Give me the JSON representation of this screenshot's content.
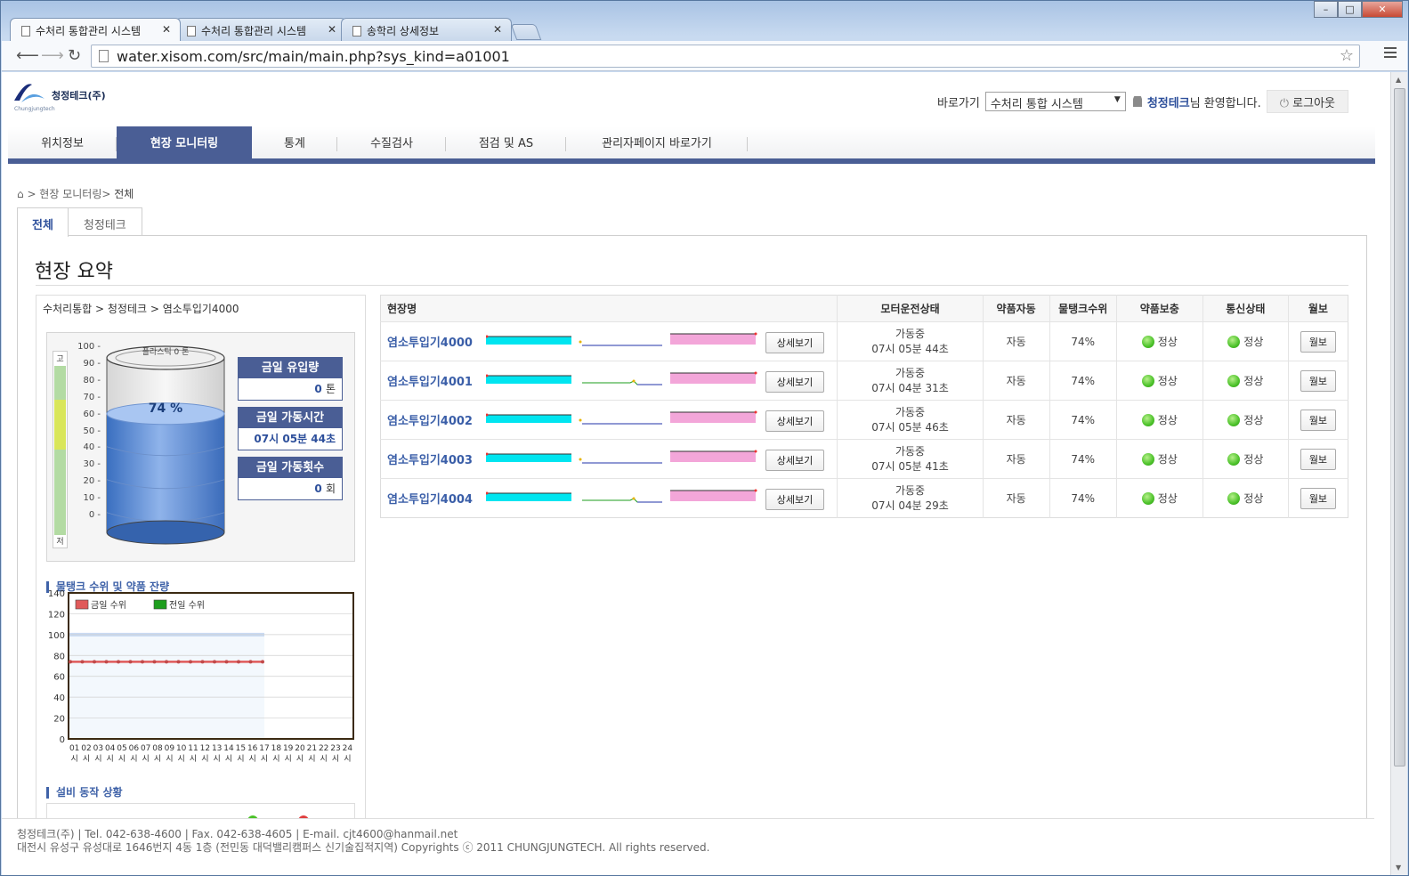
{
  "browser": {
    "tabs": [
      {
        "label": "수처리 통합관리 시스템"
      },
      {
        "label": "수처리 통합관리 시스템"
      },
      {
        "label": "송학리 상세정보"
      }
    ],
    "url": "water.xisom.com/src/main/main.php?sys_kind=a01001"
  },
  "header": {
    "logo_name": "청정테크(주)",
    "logo_sub": "Chungjungtech",
    "shortcut_label": "바로가기",
    "shortcut_selected": "수처리 통합 시스템",
    "user_name": "청정테크",
    "welcome_suffix": "님 환영합니다.",
    "logout_label": "로그아웃"
  },
  "gnb": [
    {
      "label": "위치정보"
    },
    {
      "label": "현장 모니터링"
    },
    {
      "label": "통계"
    },
    {
      "label": "수질검사"
    },
    {
      "label": "점검 및 AS"
    },
    {
      "label": "관리자페이지 바로가기"
    }
  ],
  "breadcrumb": {
    "path": " > 현장 모니터링> ",
    "current": "전체"
  },
  "page_tabs": [
    {
      "label": "전체"
    },
    {
      "label": "청정테크"
    }
  ],
  "page_title": "현장 요약",
  "left_panel": {
    "path": "수처리통합 > 청정테크 > 염소투입기4000",
    "gauge_high": "고",
    "gauge_low": "저",
    "scale": [
      "100 -",
      "90 -",
      "80 -",
      "70 -",
      "60 -",
      "50 -",
      "40 -",
      "30 -",
      "20 -",
      "10 -",
      "0 -"
    ],
    "tank_label": "플라스틱 0 톤",
    "tank_level": 0.74,
    "tank_level_text": "74 %",
    "stats": [
      {
        "title": "금일 유입량",
        "value": "0",
        "unit": "톤"
      },
      {
        "title": "금일 가동시간",
        "value": "07시 05분 44초",
        "unit": ""
      },
      {
        "title": "금일 가동횟수",
        "value": "0",
        "unit": "회"
      }
    ],
    "chart_title": "물탱크 수위 및 약품 잔량",
    "status_title": "설비 동작 상황"
  },
  "chart_data": {
    "type": "line",
    "ylim": [
      0,
      140
    ],
    "yticks": [
      0,
      20,
      40,
      60,
      80,
      100,
      120,
      140
    ],
    "categories": [
      "01시",
      "02시",
      "03시",
      "04시",
      "05시",
      "06시",
      "07시",
      "08시",
      "09시",
      "10시",
      "11시",
      "12시",
      "13시",
      "14시",
      "15시",
      "16시",
      "17시",
      "18시",
      "19시",
      "20시",
      "21시",
      "22시",
      "23시",
      "24시"
    ],
    "series": [
      {
        "name": "금일 수위",
        "color": "#e05a5a",
        "values": [
          74,
          74,
          74,
          74,
          74,
          74,
          74,
          74,
          74,
          74,
          74,
          74,
          74,
          74,
          74,
          74,
          74
        ]
      },
      {
        "name": "전일 수위",
        "color": "#1e9e1e",
        "values": []
      }
    ],
    "band_value": 100,
    "band_until_index": 16
  },
  "table": {
    "headers": [
      "현장명",
      "모터운전상태",
      "약품자동",
      "물탱크수위",
      "약품보충",
      "통신상태",
      "월보"
    ],
    "detail_label": "상세보기",
    "report_label": "월보",
    "rows": [
      {
        "name": "염소투입기4000",
        "motor": "가동중",
        "time": "07시 05분 44초",
        "auto": "자동",
        "level": "74%",
        "refill": "정상",
        "comm": "정상",
        "spark_bump": false
      },
      {
        "name": "염소투입기4001",
        "motor": "가동중",
        "time": "07시 04분 31초",
        "auto": "자동",
        "level": "74%",
        "refill": "정상",
        "comm": "정상",
        "spark_bump": true
      },
      {
        "name": "염소투입기4002",
        "motor": "가동중",
        "time": "07시 05분 46초",
        "auto": "자동",
        "level": "74%",
        "refill": "정상",
        "comm": "정상",
        "spark_bump": false
      },
      {
        "name": "염소투입기4003",
        "motor": "가동중",
        "time": "07시 05분 41초",
        "auto": "자동",
        "level": "74%",
        "refill": "정상",
        "comm": "정상",
        "spark_bump": false
      },
      {
        "name": "염소투입기4004",
        "motor": "가동중",
        "time": "07시 04분 29초",
        "auto": "자동",
        "level": "74%",
        "refill": "정상",
        "comm": "정상",
        "spark_bump": true
      }
    ]
  },
  "footer": {
    "line1": "청정테크(주) | Tel. 042-638-4600 | Fax. 042-638-4605 | E-mail. cjt4600@hanmail.net",
    "line2": "대전시 유성구 유성대로 1646번지 4동 1층 (전민동 대덕밸리캠퍼스 신기술집적지역) Copyrights ⓒ 2011 CHUNGJUNGTECH. All rights reserved."
  },
  "colors": {
    "brand": "#4a5e95",
    "link": "#3a5ea8",
    "ok": "#4cc22a"
  }
}
